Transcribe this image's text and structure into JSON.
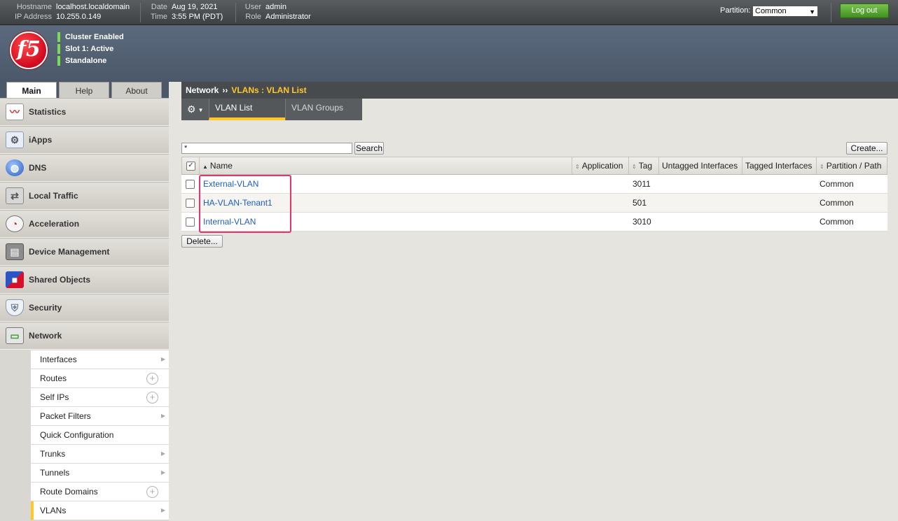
{
  "header": {
    "hostname_label": "Hostname",
    "hostname": "localhost.localdomain",
    "ip_label": "IP Address",
    "ip": "10.255.0.149",
    "date_label": "Date",
    "date": "Aug 19, 2021",
    "time_label": "Time",
    "time": "3:55 PM (PDT)",
    "user_label": "User",
    "user": "admin",
    "role_label": "Role",
    "role": "Administrator",
    "partition_label": "Partition:",
    "partition_value": "Common",
    "logout_label": "Log out"
  },
  "banner": {
    "logo_text": "f5",
    "status": [
      "Cluster Enabled",
      "Slot 1: Active",
      "Standalone"
    ],
    "status_color": "#7ed957"
  },
  "tabs": [
    {
      "label": "Main",
      "active": true
    },
    {
      "label": "Help",
      "active": false
    },
    {
      "label": "About",
      "active": false
    }
  ],
  "breadcrumb": {
    "section": "Network",
    "separator": "››",
    "current": "VLANs : VLAN List"
  },
  "subtabs": [
    {
      "label": "VLAN List",
      "active": true
    },
    {
      "label": "VLAN Groups",
      "active": false
    }
  ],
  "sidebar": {
    "items": [
      {
        "label": "Statistics",
        "icon": "chart-icon"
      },
      {
        "label": "iApps",
        "icon": "gear-icon"
      },
      {
        "label": "DNS",
        "icon": "globe-icon"
      },
      {
        "label": "Local Traffic",
        "icon": "traffic-icon"
      },
      {
        "label": "Acceleration",
        "icon": "gauge-icon"
      },
      {
        "label": "Device Management",
        "icon": "server-icon"
      },
      {
        "label": "Shared Objects",
        "icon": "cubes-icon"
      },
      {
        "label": "Security",
        "icon": "shield-icon"
      },
      {
        "label": "Network",
        "icon": "network-icon"
      }
    ],
    "network_subitems": [
      {
        "label": "Interfaces",
        "control": "arrow"
      },
      {
        "label": "Routes",
        "control": "plus"
      },
      {
        "label": "Self IPs",
        "control": "plus"
      },
      {
        "label": "Packet Filters",
        "control": "arrow"
      },
      {
        "label": "Quick Configuration",
        "control": "none"
      },
      {
        "label": "Trunks",
        "control": "arrow"
      },
      {
        "label": "Tunnels",
        "control": "arrow"
      },
      {
        "label": "Route Domains",
        "control": "plus"
      },
      {
        "label": "VLANs",
        "control": "arrow",
        "active": true
      }
    ]
  },
  "search": {
    "value": "*",
    "button_label": "Search"
  },
  "create_label": "Create...",
  "delete_label": "Delete...",
  "table": {
    "columns": [
      "Name",
      "Application",
      "Tag",
      "Untagged Interfaces",
      "Tagged Interfaces",
      "Partition / Path"
    ],
    "rows": [
      {
        "name": "External-VLAN",
        "application": "",
        "tag": "3011",
        "untagged": "",
        "tagged": "",
        "partition": "Common"
      },
      {
        "name": "HA-VLAN-Tenant1",
        "application": "",
        "tag": "501",
        "untagged": "",
        "tagged": "",
        "partition": "Common"
      },
      {
        "name": "Internal-VLAN",
        "application": "",
        "tag": "3010",
        "untagged": "",
        "tagged": "",
        "partition": "Common"
      }
    ]
  },
  "colors": {
    "accent": "#ffc72c",
    "link": "#1e5dc7",
    "highlight": "#e8336b"
  }
}
